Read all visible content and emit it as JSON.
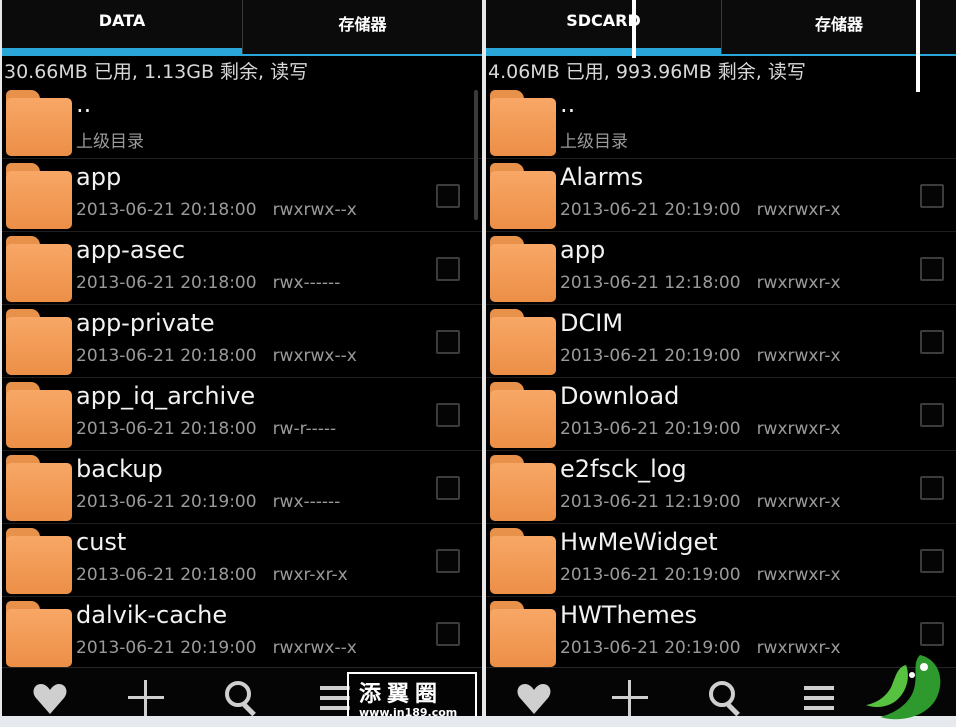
{
  "left": {
    "tabs": [
      {
        "label": "DATA"
      },
      {
        "label": "存储器"
      }
    ],
    "info": "30.66MB 已用, 1.13GB 剩余, 读写",
    "items": [
      {
        "name": "..",
        "date": "上级目录",
        "perm": ""
      },
      {
        "name": "app",
        "date": "2013-06-21 20:18:00",
        "perm": "rwxrwx--x"
      },
      {
        "name": "app-asec",
        "date": "2013-06-21 20:18:00",
        "perm": "rwx------"
      },
      {
        "name": "app-private",
        "date": "2013-06-21 20:18:00",
        "perm": "rwxrwx--x"
      },
      {
        "name": "app_iq_archive",
        "date": "2013-06-21 20:18:00",
        "perm": "rw-r-----"
      },
      {
        "name": "backup",
        "date": "2013-06-21 20:19:00",
        "perm": "rwx------"
      },
      {
        "name": "cust",
        "date": "2013-06-21 20:18:00",
        "perm": "rwxr-xr-x"
      },
      {
        "name": "dalvik-cache",
        "date": "2013-06-21 20:19:00",
        "perm": "rwxrwx--x"
      }
    ]
  },
  "right": {
    "tabs": [
      {
        "label": "SDCARD"
      },
      {
        "label": "存储器"
      }
    ],
    "info": "4.06MB 已用, 993.96MB 剩余, 读写",
    "items": [
      {
        "name": "..",
        "date": "上级目录",
        "perm": ""
      },
      {
        "name": "Alarms",
        "date": "2013-06-21 20:19:00",
        "perm": "rwxrwxr-x"
      },
      {
        "name": "app",
        "date": "2013-06-21 12:18:00",
        "perm": "rwxrwxr-x"
      },
      {
        "name": "DCIM",
        "date": "2013-06-21 20:19:00",
        "perm": "rwxrwxr-x"
      },
      {
        "name": "Download",
        "date": "2013-06-21 20:19:00",
        "perm": "rwxrwxr-x"
      },
      {
        "name": "e2fsck_log",
        "date": "2013-06-21 12:19:00",
        "perm": "rwxrwxr-x"
      },
      {
        "name": "HwMeWidget",
        "date": "2013-06-21 20:19:00",
        "perm": "rwxrwxr-x"
      },
      {
        "name": "HWThemes",
        "date": "2013-06-21 20:19:00",
        "perm": "rwxrwxr-x"
      }
    ]
  },
  "watermark": {
    "title": "添翼圈",
    "url": "www.in189.com"
  },
  "colors": {
    "accent": "#2aa6d9",
    "folder": "#f29c58",
    "background": "#000000"
  }
}
